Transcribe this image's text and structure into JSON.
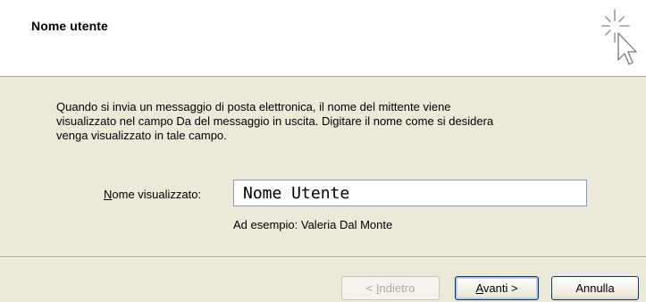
{
  "header": {
    "title": "Nome utente",
    "icon": "wizard-cursor-sparkle-icon"
  },
  "body": {
    "description": "Quando si invia un messaggio di posta elettronica, il nome del mittente viene\nvisualizzato nel campo Da del messaggio in uscita. Digitare il nome come si desidera\nvenga visualizzato in tale campo.",
    "display_name_label_accel": "N",
    "display_name_label_rest": "ome visualizzato:",
    "display_name_value": "Nome Utente",
    "example": "Ad esempio: Valeria Dal Monte"
  },
  "footer": {
    "back_prefix": "< ",
    "back_accel": "I",
    "back_rest": "ndietro",
    "next_accel": "A",
    "next_rest": "vanti >",
    "cancel_label": "Annulla"
  }
}
